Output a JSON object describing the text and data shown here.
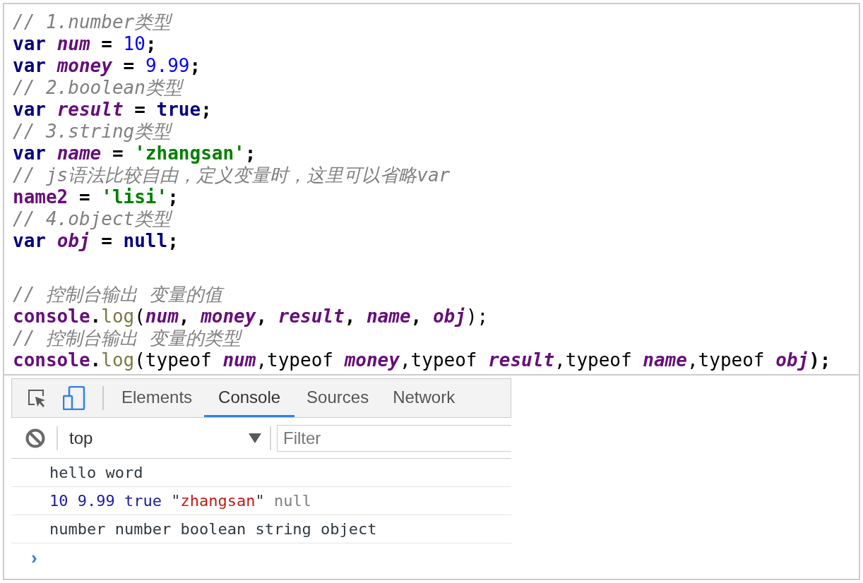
{
  "code_lines": [
    {
      "kind": "code",
      "tokens": [
        {
          "kind": "comment",
          "text": "// 1.number类型"
        }
      ]
    },
    {
      "kind": "code",
      "tokens": [
        {
          "kind": "keyword",
          "text": "var "
        },
        {
          "kind": "variable",
          "text": "num"
        },
        {
          "kind": "plain",
          "text": " = "
        },
        {
          "kind": "number",
          "text": "10"
        },
        {
          "kind": "plain",
          "text": ";"
        }
      ]
    },
    {
      "kind": "code",
      "tokens": [
        {
          "kind": "keyword",
          "text": "var "
        },
        {
          "kind": "variable",
          "text": "money"
        },
        {
          "kind": "plain",
          "text": " = "
        },
        {
          "kind": "number",
          "text": "9.99"
        },
        {
          "kind": "plain",
          "text": ";"
        }
      ]
    },
    {
      "kind": "code",
      "tokens": [
        {
          "kind": "comment",
          "text": "// 2.boolean类型"
        }
      ]
    },
    {
      "kind": "code",
      "tokens": [
        {
          "kind": "keyword",
          "text": "var "
        },
        {
          "kind": "variable",
          "text": "result"
        },
        {
          "kind": "plain",
          "text": " = "
        },
        {
          "kind": "keyword",
          "text": "true"
        },
        {
          "kind": "plain",
          "text": ";"
        }
      ]
    },
    {
      "kind": "code",
      "tokens": [
        {
          "kind": "comment",
          "text": "// 3.string类型"
        }
      ]
    },
    {
      "kind": "code",
      "tokens": [
        {
          "kind": "keyword",
          "text": "var "
        },
        {
          "kind": "variable",
          "text": "name"
        },
        {
          "kind": "plain",
          "text": " = "
        },
        {
          "kind": "string",
          "text": "'zhangsan'"
        },
        {
          "kind": "plain",
          "text": ";"
        }
      ]
    },
    {
      "kind": "code",
      "tokens": [
        {
          "kind": "comment",
          "text": "// js语法比较自由，定义变量时，这里可以省略var"
        }
      ]
    },
    {
      "kind": "code",
      "tokens": [
        {
          "kind": "global",
          "text": "name2"
        },
        {
          "kind": "plain",
          "text": " = "
        },
        {
          "kind": "string",
          "text": "'lisi'"
        },
        {
          "kind": "plain",
          "text": ";"
        }
      ]
    },
    {
      "kind": "code",
      "tokens": [
        {
          "kind": "comment",
          "text": "// 4.object类型"
        }
      ]
    },
    {
      "kind": "code",
      "tokens": [
        {
          "kind": "keyword",
          "text": "var "
        },
        {
          "kind": "variable",
          "text": "obj"
        },
        {
          "kind": "plain",
          "text": " = "
        },
        {
          "kind": "keyword",
          "text": "null"
        },
        {
          "kind": "plain",
          "text": ";"
        }
      ]
    },
    {
      "kind": "blank"
    },
    {
      "kind": "code",
      "tokens": [
        {
          "kind": "comment",
          "text": "// 控制台输出 变量的值"
        }
      ]
    },
    {
      "kind": "code",
      "tokens": [
        {
          "kind": "global",
          "text": "console"
        },
        {
          "kind": "plain",
          "text": "."
        },
        {
          "kind": "method",
          "text": "log"
        },
        {
          "kind": "text",
          "text": "("
        },
        {
          "kind": "variable",
          "text": "num"
        },
        {
          "kind": "plain",
          "text": ", "
        },
        {
          "kind": "variable",
          "text": "money"
        },
        {
          "kind": "plain",
          "text": ", "
        },
        {
          "kind": "variable",
          "text": "result"
        },
        {
          "kind": "plain",
          "text": ", "
        },
        {
          "kind": "variable",
          "text": "name"
        },
        {
          "kind": "plain",
          "text": ", "
        },
        {
          "kind": "variable",
          "text": "obj"
        },
        {
          "kind": "text",
          "text": ");"
        }
      ]
    },
    {
      "kind": "code",
      "tokens": [
        {
          "kind": "comment",
          "text": "// 控制台输出 变量的类型"
        }
      ]
    },
    {
      "kind": "code",
      "tokens": [
        {
          "kind": "global",
          "text": "console"
        },
        {
          "kind": "plain",
          "text": "."
        },
        {
          "kind": "method",
          "text": "log"
        },
        {
          "kind": "text",
          "text": "(typeof "
        },
        {
          "kind": "variable",
          "text": "num"
        },
        {
          "kind": "text",
          "text": ",typeof "
        },
        {
          "kind": "variable",
          "text": "money"
        },
        {
          "kind": "text",
          "text": ",typeof "
        },
        {
          "kind": "variable",
          "text": "result"
        },
        {
          "kind": "text",
          "text": ",typeof "
        },
        {
          "kind": "variable",
          "text": "name"
        },
        {
          "kind": "text",
          "text": ",typeof "
        },
        {
          "kind": "variable",
          "text": "obj"
        },
        {
          "kind": "plain",
          "text": ");"
        }
      ]
    }
  ],
  "devtools": {
    "tabs": [
      {
        "label": "Elements",
        "selected": false
      },
      {
        "label": "Console",
        "selected": true
      },
      {
        "label": "Sources",
        "selected": false
      },
      {
        "label": "Network",
        "selected": false
      }
    ],
    "context": "top",
    "filter": {
      "placeholder": "Filter"
    },
    "messages": [
      {
        "tokens": [
          {
            "kind": "text",
            "text": "hello word"
          }
        ]
      },
      {
        "tokens": [
          {
            "kind": "number",
            "text": "10 9.99 true "
          },
          {
            "kind": "text",
            "text": "\""
          },
          {
            "kind": "string",
            "text": "zhangsan"
          },
          {
            "kind": "text",
            "text": "\" "
          },
          {
            "kind": "null",
            "text": "null"
          }
        ]
      },
      {
        "tokens": [
          {
            "kind": "text",
            "text": "number number boolean string object"
          }
        ]
      }
    ],
    "prompt": "›"
  }
}
